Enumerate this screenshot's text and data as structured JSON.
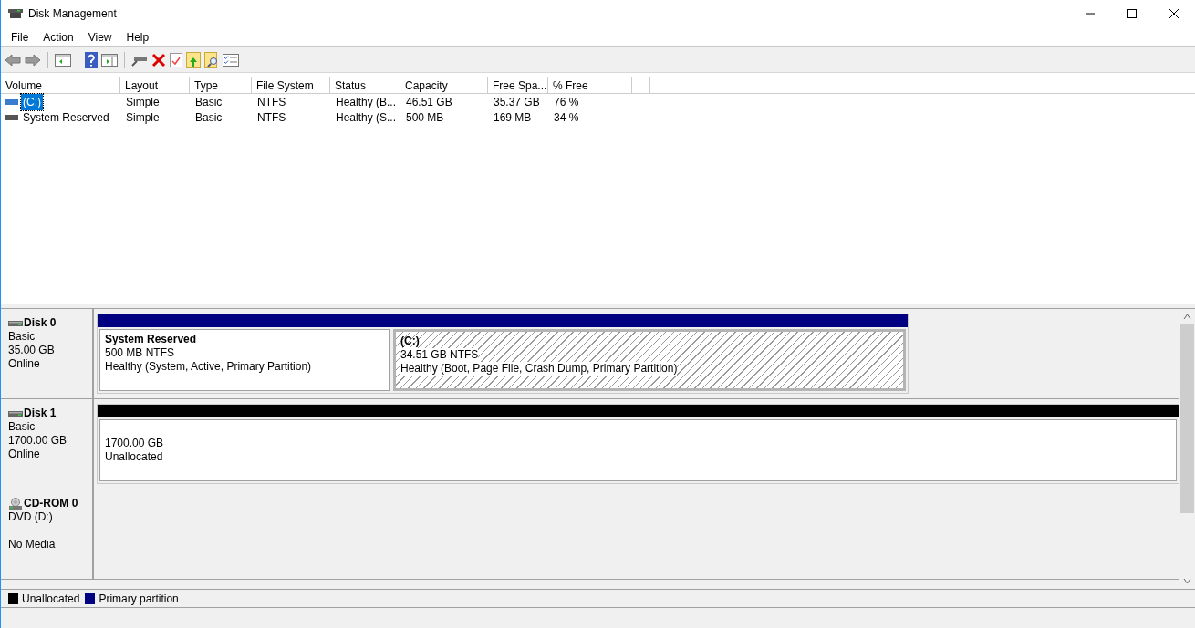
{
  "window": {
    "title": "Disk Management"
  },
  "menu": [
    "File",
    "Action",
    "View",
    "Help"
  ],
  "volume_table": {
    "columns": [
      "Volume",
      "Layout",
      "Type",
      "File System",
      "Status",
      "Capacity",
      "Free Spa...",
      "% Free"
    ],
    "rows": [
      {
        "cells": [
          "(C:)",
          "Simple",
          "Basic",
          "NTFS",
          "Healthy (B...",
          "46.51 GB",
          "35.37 GB",
          "76 %"
        ],
        "selected": true
      },
      {
        "cells": [
          "System Reserved",
          "Simple",
          "Basic",
          "NTFS",
          "Healthy (S...",
          "500 MB",
          "169 MB",
          "34 %"
        ],
        "selected": false
      }
    ]
  },
  "disks": [
    {
      "kind": "disk",
      "name": "Disk 0",
      "lines": [
        "Basic",
        "35.00 GB",
        "Online"
      ],
      "partitions": [
        {
          "name": "System Reserved",
          "size": "500 MB NTFS",
          "status": "Healthy (System, Active, Primary Partition)",
          "color": "#000080",
          "selected": false
        },
        {
          "name": "(C:)",
          "size": "34.51 GB NTFS",
          "status": "Healthy (Boot, Page File, Crash Dump, Primary Partition)",
          "color": "#000080",
          "selected": true
        }
      ]
    },
    {
      "kind": "disk",
      "name": "Disk 1",
      "lines": [
        "Basic",
        "1700.00 GB",
        "Online"
      ],
      "partitions": [
        {
          "size": "1700.00 GB",
          "status": "Unallocated",
          "color": "#000000",
          "selected": false
        }
      ]
    },
    {
      "kind": "cdrom",
      "name": "CD-ROM 0",
      "lines": [
        "DVD (D:)",
        "No Media"
      ]
    }
  ],
  "legend": [
    {
      "label": "Unallocated",
      "color": "#000000"
    },
    {
      "label": "Primary partition",
      "color": "#000080"
    }
  ]
}
